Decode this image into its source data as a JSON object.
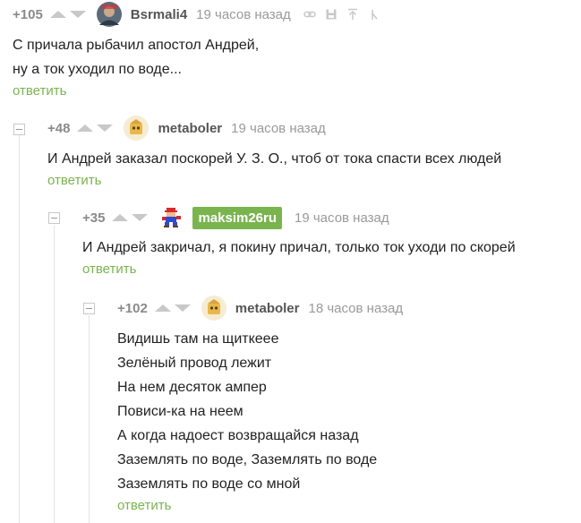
{
  "comments": [
    {
      "rating": "+105",
      "author": "Bsrmali4",
      "time": "19 часов назад",
      "lines": [
        "С причала рыбачил апостол Андрей,",
        "ну а ток уходил по воде..."
      ],
      "reply": "ответить"
    },
    {
      "rating": "+48",
      "author": "metaboler",
      "time": "19 часов назад",
      "lines": [
        "И Андрей заказал поскорей У. З. О., чтоб от тока спасти всех людей"
      ],
      "reply": "ответить"
    },
    {
      "rating": "+35",
      "author": "maksim26ru",
      "time": "19 часов назад",
      "lines": [
        "И Андрей закричал, я покину причал, только ток уходи по скорей"
      ],
      "reply": "ответить"
    },
    {
      "rating": "+102",
      "author": "metaboler",
      "time": "18 часов назад",
      "lines": [
        "Видишь там на щиткеее",
        "Зелёный провод лежит",
        "На нем десяток ампер",
        "Повиси-ка на неем",
        "А когда надоест возвращайся назад",
        "Заземлять по воде, Заземлять по воде",
        "Заземлять по воде со мной"
      ],
      "reply": "ответить"
    }
  ],
  "colors": {
    "reply_link": "#7ab44f",
    "author_badge": "#7ab44f",
    "meta_text": "#9a9a9a"
  },
  "icons": [
    "link-icon",
    "save-icon",
    "go-to-parent-icon",
    "compare-icon",
    "collapse-toggle-icon"
  ]
}
